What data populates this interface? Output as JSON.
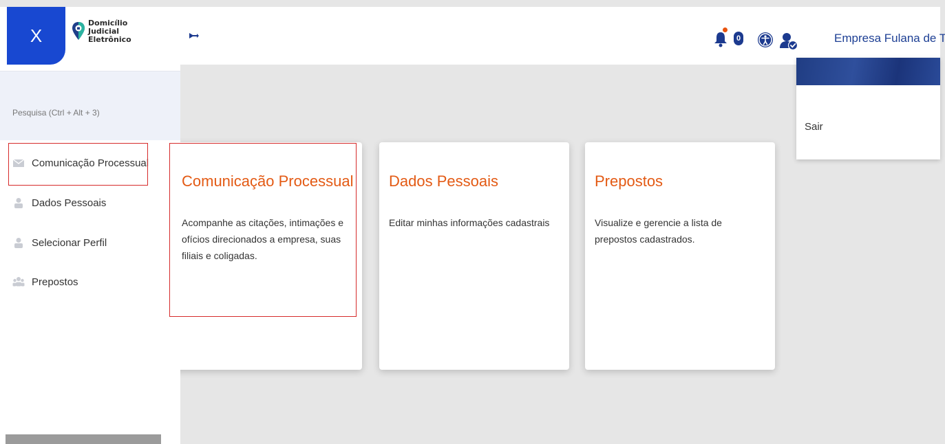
{
  "sidebar": {
    "close_label": "X",
    "brand": {
      "line1": "Domicílio",
      "line2": "Judicial",
      "line3": "Eletrônico"
    },
    "search": {
      "placeholder": "Pesquisa (Ctrl + Alt + 3)"
    },
    "items": [
      {
        "label": "Comunicação Processual",
        "icon": "mail-icon"
      },
      {
        "label": "Dados Pessoais",
        "icon": "person-icon"
      },
      {
        "label": "Selecionar Perfil",
        "icon": "person-icon"
      },
      {
        "label": "Prepostos",
        "icon": "group-icon"
      }
    ]
  },
  "header": {
    "icons": [
      "pin-icon",
      "bell-icon",
      "accessibility-icon",
      "user-check-icon"
    ],
    "notification_count": "0",
    "company_name": "Empresa Fulana de Tal"
  },
  "user_menu": {
    "logout_label": "Sair"
  },
  "cards": [
    {
      "title": "Comunicação Processual",
      "description": "Acompanhe as citações, intimações e ofícios direcionados a empresa, suas filiais e coligadas."
    },
    {
      "title": "Dados Pessoais",
      "description": "Editar minhas informações cadastrais"
    },
    {
      "title": "Prepostos",
      "description": "Visualize e gerencie a lista de prepostos cadastrados."
    }
  ],
  "colors": {
    "primary_blue": "#1848d1",
    "dark_blue": "#1d3f94",
    "accent_orange": "#e35a14",
    "highlight_red": "#d62a2a",
    "background": "#e6e6e6"
  }
}
